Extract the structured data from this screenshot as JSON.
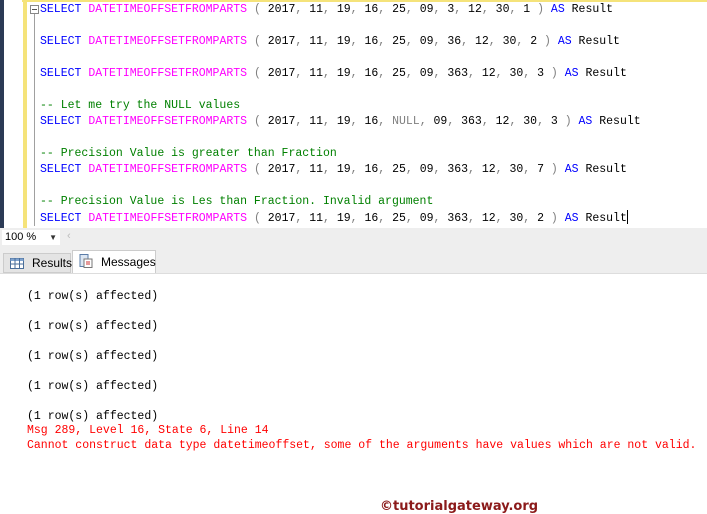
{
  "editor": {
    "lines": [
      {
        "type": "query",
        "kw": "SELECT",
        "fn": "DATETIMEOFFSETFROMPARTS",
        "open": "(",
        "args": [
          "2017",
          "11",
          "19",
          "16",
          "25",
          "09",
          "3",
          "12",
          "30",
          "1"
        ],
        "close": ")",
        "as": "AS",
        "alias": "Result"
      },
      {
        "type": "query",
        "kw": "SELECT",
        "fn": "DATETIMEOFFSETFROMPARTS",
        "open": "(",
        "args": [
          "2017",
          "11",
          "19",
          "16",
          "25",
          "09",
          "36",
          "12",
          "30",
          "2"
        ],
        "close": ")",
        "as": "AS",
        "alias": "Result"
      },
      {
        "type": "query",
        "kw": "SELECT",
        "fn": "DATETIMEOFFSETFROMPARTS",
        "open": "(",
        "args": [
          "2017",
          "11",
          "19",
          "16",
          "25",
          "09",
          "363",
          "12",
          "30",
          "3"
        ],
        "close": ")",
        "as": "AS",
        "alias": "Result"
      },
      {
        "type": "comment",
        "text": "-- Let me try the NULL values"
      },
      {
        "type": "query",
        "kw": "SELECT",
        "fn": "DATETIMEOFFSETFROMPARTS",
        "open": "(",
        "args": [
          "2017",
          "11",
          "19",
          "16",
          "NULL",
          "09",
          "363",
          "12",
          "30",
          "3"
        ],
        "close": ")",
        "as": "AS",
        "alias": "Result"
      },
      {
        "type": "comment",
        "text": "-- Precision Value is greater than Fraction"
      },
      {
        "type": "query",
        "kw": "SELECT",
        "fn": "DATETIMEOFFSETFROMPARTS",
        "open": "(",
        "args": [
          "2017",
          "11",
          "19",
          "16",
          "25",
          "09",
          "363",
          "12",
          "30",
          "7"
        ],
        "close": ")",
        "as": "AS",
        "alias": "Result"
      },
      {
        "type": "comment",
        "text": "-- Precision Value is Les than Fraction. Invalid argument"
      },
      {
        "type": "query",
        "kw": "SELECT",
        "fn": "DATETIMEOFFSETFROMPARTS",
        "open": "(",
        "args": [
          "2017",
          "11",
          "19",
          "16",
          "25",
          "09",
          "363",
          "12",
          "30",
          "2"
        ],
        "close": ")",
        "as": "AS",
        "alias": "Result",
        "caret": true
      }
    ]
  },
  "toolbar": {
    "zoom_value": "100 %"
  },
  "tabs": {
    "results": "Results",
    "messages": "Messages"
  },
  "watermark": "©tutorialgateway.org",
  "messages": {
    "rows_affected": [
      "(1 row(s) affected)",
      "(1 row(s) affected)",
      "(1 row(s) affected)",
      "(1 row(s) affected)",
      "(1 row(s) affected)"
    ],
    "error_header": "Msg 289, Level 16, State 6, Line 14",
    "error_text": "Cannot construct data type datetimeoffset, some of the arguments have values which are not valid."
  },
  "colors": {
    "keyword": "#0000ff",
    "function": "#ff00ff",
    "comment": "#008000",
    "error": "#ff0000"
  }
}
